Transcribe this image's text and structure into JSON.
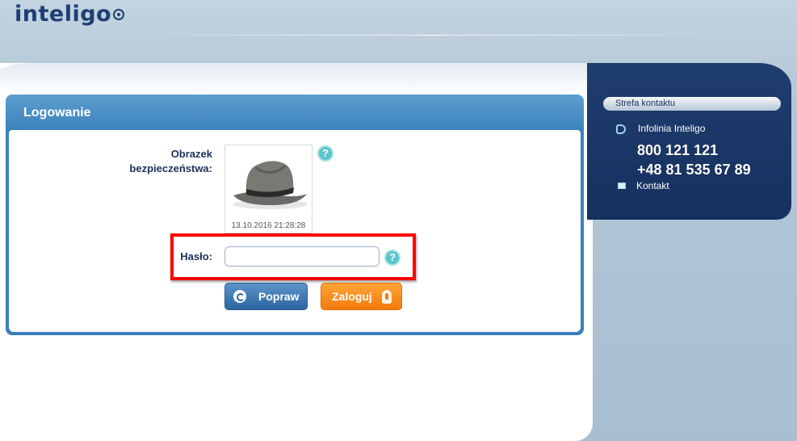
{
  "header": {
    "logo_text": "inteligo"
  },
  "login": {
    "title": "Logowanie",
    "security_image_label_line1": "Obrazek",
    "security_image_label_line2": "bezpieczeństwa:",
    "security_image_date": "13.10.2016 21:28:28",
    "password_label": "Hasło:",
    "password_value": "",
    "popraw_label": "Popraw",
    "zaloguj_label": "Zaloguj"
  },
  "contact": {
    "header": "Strefa kontaktu",
    "infolinia_label": "Infolinia Inteligo",
    "phone_1": "800 121 121",
    "phone_2": "+48 81 535 67 89",
    "kontakt_label": "Kontakt"
  },
  "colors": {
    "brand_dark_blue": "#1d3f73",
    "login_header_blue": "#3b82bd",
    "contact_panel_navy": "#1f3d6f",
    "zaloguj_orange": "#f27b0a",
    "help_teal": "#5ac5c8",
    "highlight_red": "#ff0000"
  },
  "icons": {
    "help": "help-icon",
    "phone": "phone-icon",
    "mail": "mail-icon",
    "popraw": "undo-icon",
    "zaloguj": "key-icon"
  }
}
